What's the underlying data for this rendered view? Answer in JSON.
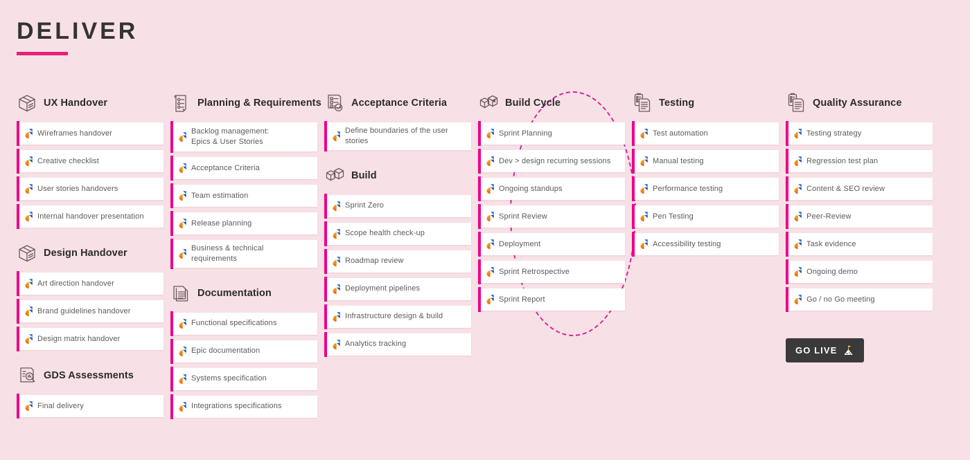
{
  "page": {
    "title": "DELIVER",
    "accent_magenta": "#ec008c",
    "accent_underline": "#ec1e79",
    "background": "#f8e1e6",
    "card_background": "#ffffff",
    "text_color": "#5a5a5a",
    "heading_color": "#2b2b2b"
  },
  "go_live": {
    "label": "GO LIVE",
    "icon": "mountain-flag-icon",
    "background": "#3a3a3a",
    "text_color": "#ffffff"
  },
  "columns": [
    {
      "id": "column-1",
      "sections": [
        {
          "id": "ux-handover",
          "title": "UX Handover",
          "icon": "package-box-icon",
          "items": [
            {
              "label": "Wireframes handover"
            },
            {
              "label": "Creative checklist"
            },
            {
              "label": "User stories handovers"
            },
            {
              "label": "Internal handover presentation"
            }
          ]
        },
        {
          "id": "design-handover",
          "title": "Design Handover",
          "icon": "package-box-icon",
          "items": [
            {
              "label": "Art direction handover"
            },
            {
              "label": "Brand guidelines handover"
            },
            {
              "label": "Design matrix handover"
            }
          ]
        },
        {
          "id": "gds-assessments",
          "title": "GDS Assessments",
          "icon": "document-magnifier-icon",
          "items": [
            {
              "label": "Final delivery"
            }
          ]
        }
      ]
    },
    {
      "id": "column-2",
      "sections": [
        {
          "id": "planning-requirements",
          "title": "Planning & Requirements",
          "icon": "scroll-checklist-icon",
          "items": [
            {
              "label": "Backlog management:\nEpics & User Stories",
              "tall": true
            },
            {
              "label": "Acceptance Criteria"
            },
            {
              "label": "Team estimation"
            },
            {
              "label": "Release planning"
            },
            {
              "label": "Business & technical requirements"
            }
          ]
        },
        {
          "id": "documentation",
          "title": "Documentation",
          "icon": "documents-icon",
          "items": [
            {
              "label": "Functional specifications"
            },
            {
              "label": "Epic documentation"
            },
            {
              "label": "Systems specification"
            },
            {
              "label": "Integrations specifications"
            }
          ]
        }
      ]
    },
    {
      "id": "column-3",
      "sections": [
        {
          "id": "acceptance-criteria",
          "title": "Acceptance Criteria",
          "icon": "checklist-approved-icon",
          "items": [
            {
              "label": "Define boundaries of the user stories"
            }
          ]
        },
        {
          "id": "build",
          "title": "Build",
          "icon": "two-boxes-icon",
          "items": [
            {
              "label": "Sprint Zero"
            },
            {
              "label": "Scope health check-up"
            },
            {
              "label": "Roadmap review"
            },
            {
              "label": "Deployment pipelines"
            },
            {
              "label": "Infrastructure design & build"
            },
            {
              "label": "Analytics tracking"
            }
          ]
        }
      ]
    },
    {
      "id": "column-4",
      "has_cycle_ring": true,
      "sections": [
        {
          "id": "build-cycle",
          "title": "Build Cycle",
          "icon": "boxes-cycle-icon",
          "items": [
            {
              "label": "Sprint Planning"
            },
            {
              "label": "Dev > design recurring sessions"
            },
            {
              "label": "Ongoing standups"
            },
            {
              "label": "Sprint Review"
            },
            {
              "label": "Deployment"
            },
            {
              "label": "Sprint Retrospective"
            },
            {
              "label": "Sprint Report"
            }
          ]
        }
      ]
    },
    {
      "id": "column-5",
      "sections": [
        {
          "id": "testing",
          "title": "Testing",
          "icon": "clipboard-document-icon",
          "items": [
            {
              "label": "Test automation"
            },
            {
              "label": "Manual testing"
            },
            {
              "label": "Performance testing"
            },
            {
              "label": "Pen Testing"
            },
            {
              "label": "Accessibility testing"
            }
          ]
        }
      ]
    },
    {
      "id": "column-6",
      "has_go_live": true,
      "sections": [
        {
          "id": "quality-assurance",
          "title": "Quality Assurance",
          "icon": "clipboard-document-icon",
          "items": [
            {
              "label": "Testing strategy"
            },
            {
              "label": "Regression test plan"
            },
            {
              "label": "Content & SEO review"
            },
            {
              "label": "Peer-Review"
            },
            {
              "label": "Task evidence"
            },
            {
              "label": "Ongoing demo"
            },
            {
              "label": "Go / no Go meeting"
            }
          ]
        }
      ]
    }
  ]
}
